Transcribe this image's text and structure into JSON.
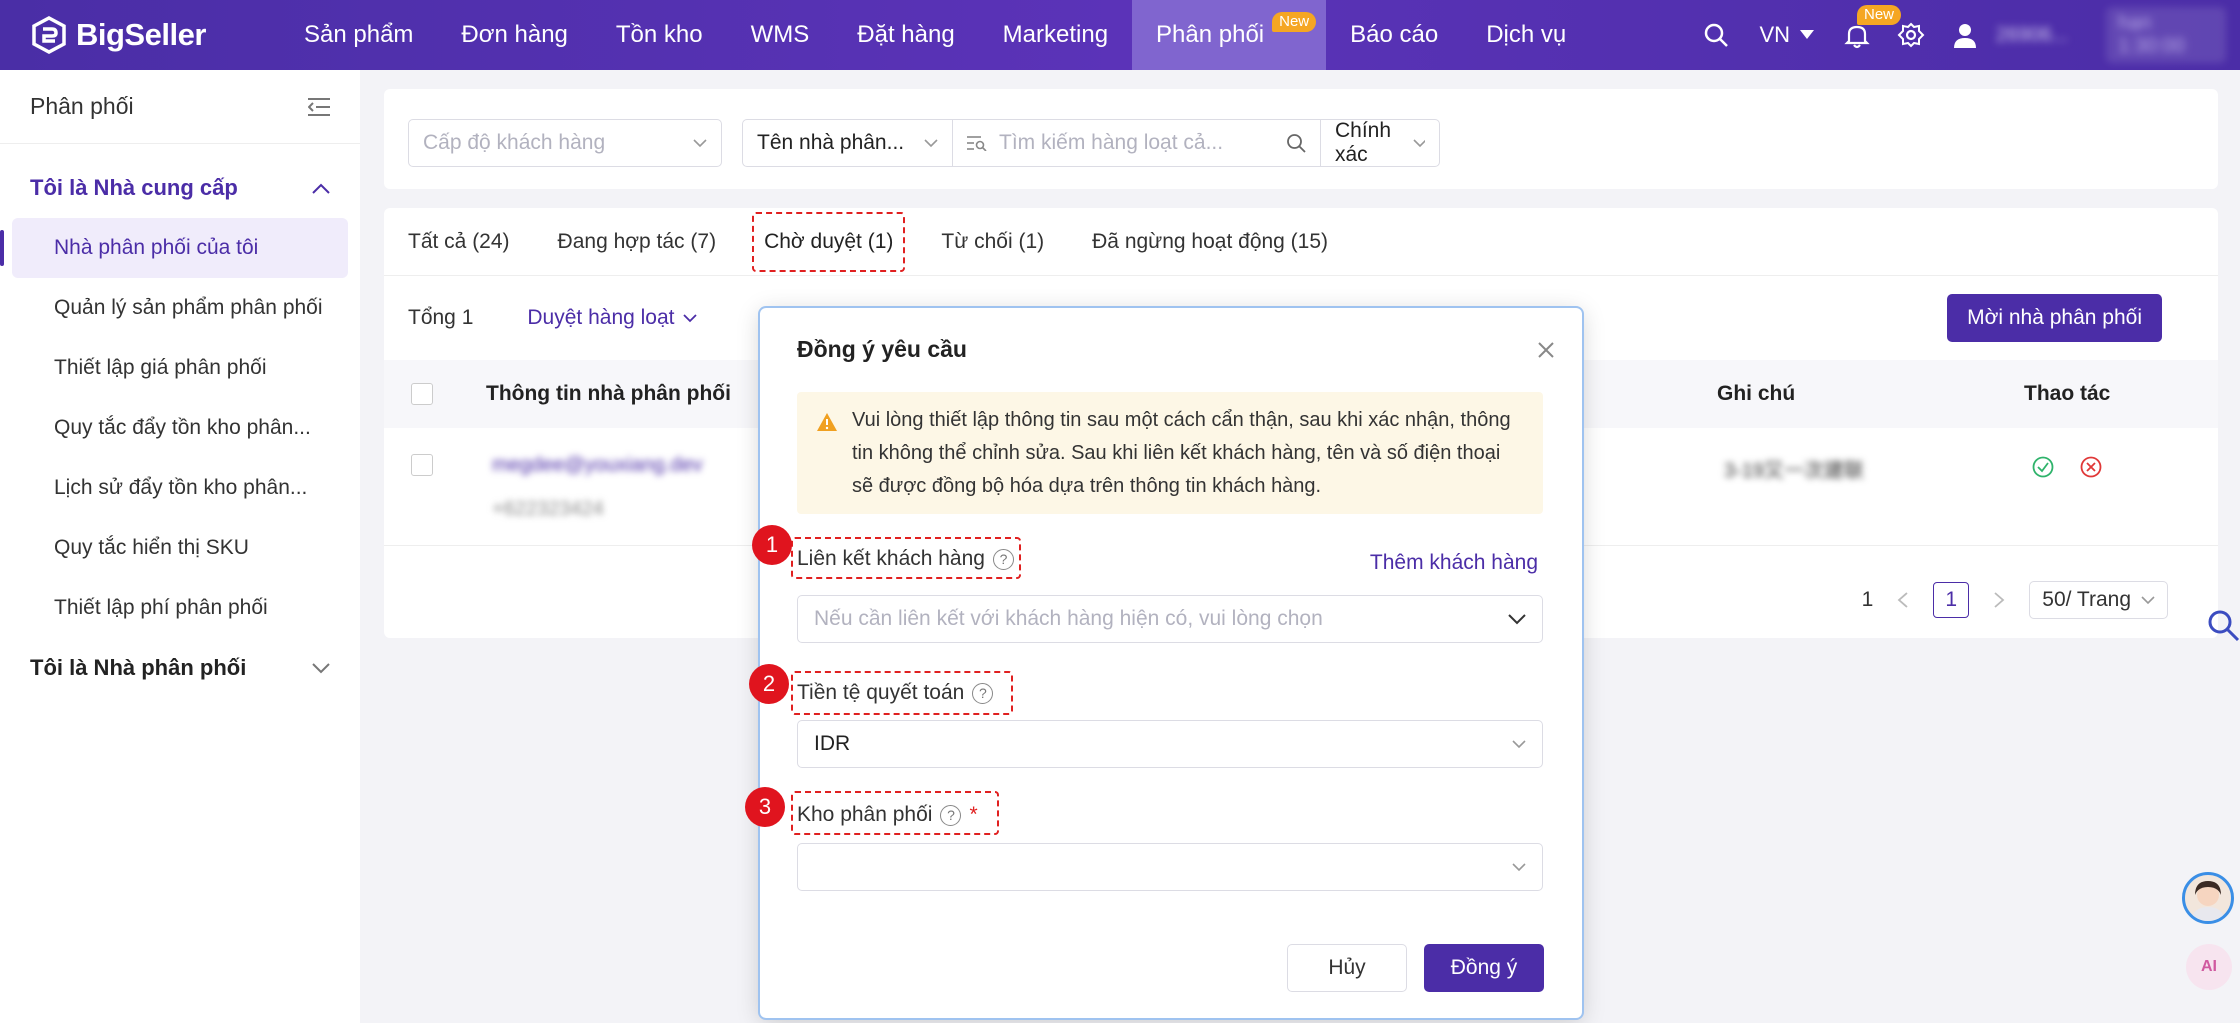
{
  "topnav": {
    "brand": "BigSeller",
    "items": [
      {
        "label": "Sản phẩm"
      },
      {
        "label": "Đơn hàng"
      },
      {
        "label": "Tồn kho"
      },
      {
        "label": "WMS"
      },
      {
        "label": "Đặt hàng"
      },
      {
        "label": "Marketing"
      },
      {
        "label": "Phân phối",
        "badge": "New",
        "active": true
      },
      {
        "label": "Báo cáo"
      },
      {
        "label": "Dịch vụ"
      }
    ],
    "language": "VN",
    "notification_badge": "New",
    "user_name": "26906...",
    "expiry": "hạn 1:30:00"
  },
  "sidebar": {
    "title": "Phân phối",
    "group1": "Tôi là Nhà cung cấp",
    "items": [
      {
        "label": "Nhà phân phối của tôi",
        "active": true
      },
      {
        "label": "Quản lý sản phẩm phân phối"
      },
      {
        "label": "Thiết lập giá phân phối"
      },
      {
        "label": "Quy tắc đẩy tồn kho phân..."
      },
      {
        "label": "Lịch sử đẩy tồn kho phân..."
      },
      {
        "label": "Quy tắc hiển thị SKU"
      },
      {
        "label": "Thiết lập phí phân phối"
      }
    ],
    "group2": "Tôi là Nhà phân phối"
  },
  "filters": {
    "customer_level_placeholder": "Cấp độ khách hàng",
    "distributor_name_select": "Tên nhà phân...",
    "search_placeholder": "Tìm kiếm hàng loạt cả...",
    "match_mode": "Chính xác"
  },
  "tabs": [
    {
      "label": "Tất cả (24)"
    },
    {
      "label": "Đang hợp tác (7)"
    },
    {
      "label": "Chờ duyệt (1)",
      "active": true
    },
    {
      "label": "Từ chối (1)"
    },
    {
      "label": "Đã ngừng hoạt động (15)"
    }
  ],
  "toolbar": {
    "total": "Tổng 1",
    "batch_approve": "Duyệt hàng loạt",
    "invite_button": "Mời nhà phân phối"
  },
  "table": {
    "columns": {
      "info": "Thông tin nhà phân phối",
      "note": "Ghi chú",
      "action": "Thao tác"
    },
    "rows": [
      {
        "email": "megdee@youxiang.dev",
        "phone": "+622323424",
        "note": "3-19又一次建联"
      }
    ]
  },
  "pagination": {
    "total_pages": "1",
    "current": "1",
    "page_size": "50/ Trang"
  },
  "modal": {
    "title": "Đồng ý yêu cầu",
    "alert": "Vui lòng thiết lập thông tin sau một cách cẩn thận, sau khi xác nhận, thông tin không thể chỉnh sửa. Sau khi liên kết khách hàng, tên và số điện thoại sẽ được đồng bộ hóa dựa trên thông tin khách hàng.",
    "field1_label": "Liên kết khách hàng",
    "add_customer": "Thêm khách hàng",
    "field1_placeholder": "Nếu cần liên kết với khách hàng hiện có, vui lòng chọn",
    "field2_label": "Tiền tệ quyết toán",
    "field2_value": "IDR",
    "field3_label": "Kho phân phối",
    "field3_required": "*",
    "cancel": "Hủy",
    "confirm": "Đồng ý"
  },
  "annotations": {
    "n1": "1",
    "n2": "2",
    "n3": "3"
  },
  "colors": {
    "brand": "#4b2da7",
    "annotation": "#e0141e",
    "alert_bg": "#fdf7e6"
  }
}
